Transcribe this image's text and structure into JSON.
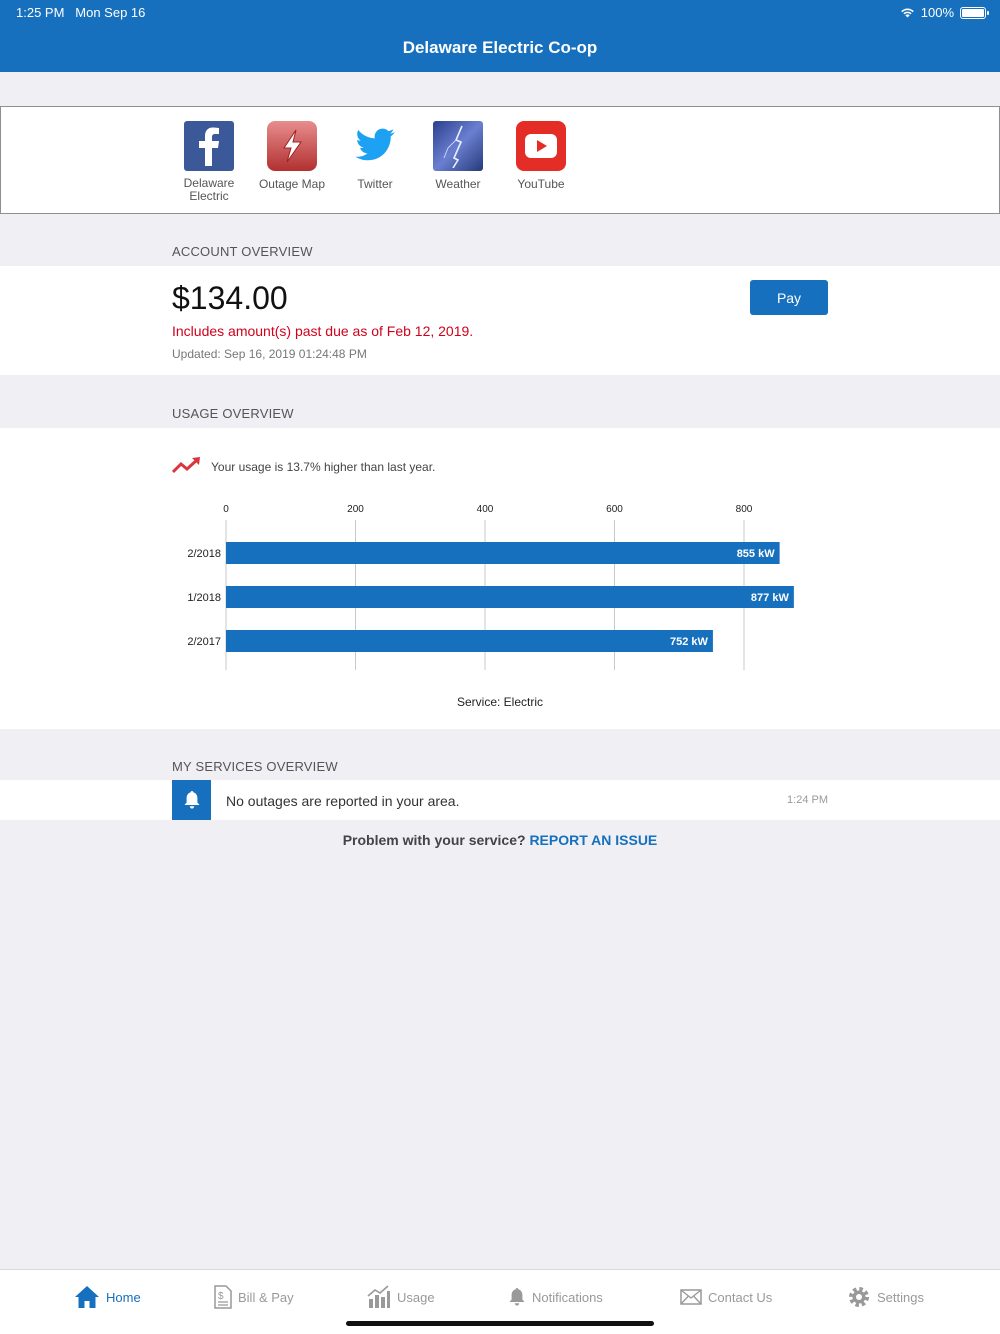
{
  "status_bar": {
    "time": "1:25 PM",
    "date": "Mon Sep 16",
    "battery": "100%"
  },
  "header": {
    "title": "Delaware Electric Co-op"
  },
  "social": [
    {
      "label": "Delaware\nElectric",
      "icon": "facebook-icon"
    },
    {
      "label": "Outage Map",
      "icon": "outage-map-icon"
    },
    {
      "label": "Twitter",
      "icon": "twitter-icon"
    },
    {
      "label": "Weather",
      "icon": "weather-icon"
    },
    {
      "label": "YouTube",
      "icon": "youtube-icon"
    }
  ],
  "account": {
    "heading": "ACCOUNT OVERVIEW",
    "amount": "$134.00",
    "past_due": "Includes amount(s) past due as of Feb 12, 2019.",
    "updated": "Updated: Sep 16, 2019 01:24:48 PM",
    "pay_label": "Pay"
  },
  "usage": {
    "heading": "USAGE OVERVIEW",
    "trend_text": "Your usage is 13.7% higher than last year.",
    "service_label": "Service: Electric"
  },
  "chart_data": {
    "type": "bar",
    "orientation": "horizontal",
    "categories": [
      "2/2018",
      "1/2018",
      "2/2017"
    ],
    "values": [
      855,
      877,
      752
    ],
    "value_labels": [
      "855 kW",
      "877 kW",
      "752 kW"
    ],
    "x_ticks": [
      0,
      200,
      400,
      600,
      800
    ],
    "xlim": [
      0,
      800
    ],
    "grid": true,
    "bar_color": "#1670bd"
  },
  "services": {
    "heading": "MY SERVICES OVERVIEW",
    "notification": "No outages are reported in your area.",
    "time": "1:24 PM"
  },
  "report": {
    "prefix": "Problem with your service?",
    "link": "REPORT AN ISSUE"
  },
  "tabs": [
    {
      "label": "Home",
      "icon": "home-icon",
      "active": true
    },
    {
      "label": "Bill & Pay",
      "icon": "bill-icon",
      "active": false
    },
    {
      "label": "Usage",
      "icon": "usage-icon",
      "active": false
    },
    {
      "label": "Notifications",
      "icon": "bell-icon",
      "active": false
    },
    {
      "label": "Contact Us",
      "icon": "mail-icon",
      "active": false
    },
    {
      "label": "Settings",
      "icon": "gear-icon",
      "active": false
    }
  ],
  "colors": {
    "primary": "#1670bd",
    "alert": "#d0021b",
    "background": "#efeff4"
  }
}
